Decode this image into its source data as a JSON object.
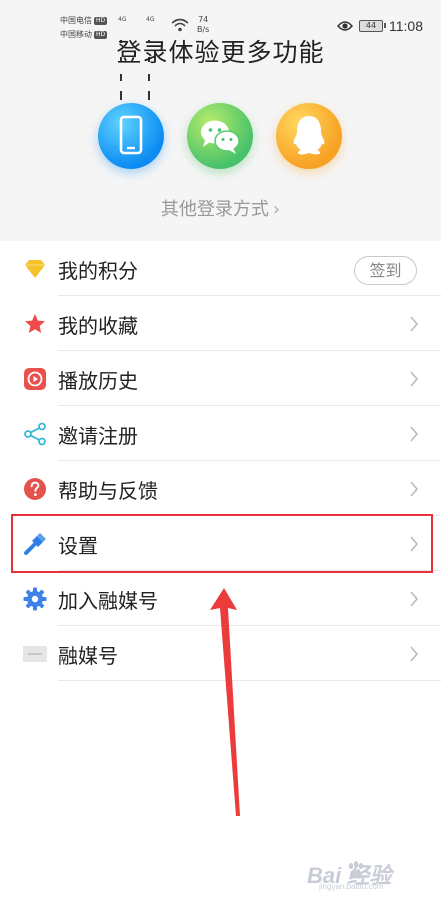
{
  "status_bar": {
    "carrier1": "中国电信",
    "carrier2": "中国移动",
    "hd": "HD",
    "network1": "4G",
    "network2": "4G",
    "speed_value": "74",
    "speed_unit": "B/s",
    "battery": "44",
    "time": "11:08"
  },
  "login": {
    "title": "登录体验更多功能",
    "options": [
      "phone-icon",
      "wechat-icon",
      "qq-icon"
    ],
    "other_login": "其他登录方式",
    "other_login_chevron": "›"
  },
  "menu": {
    "items": [
      {
        "label": "我的积分",
        "icon": "diamond-icon",
        "action": "签到"
      },
      {
        "label": "我的收藏",
        "icon": "star-icon"
      },
      {
        "label": "播放历史",
        "icon": "play-history-icon"
      },
      {
        "label": "邀请注册",
        "icon": "share-icon"
      },
      {
        "label": "帮助与反馈",
        "icon": "help-icon"
      },
      {
        "label": "设置",
        "icon": "settings-wrench-icon"
      },
      {
        "label": "加入融媒号",
        "icon": "gear-icon"
      },
      {
        "label": "融媒号",
        "icon": "media-thumbnail-icon"
      }
    ]
  },
  "annotation": {
    "highlight_color": "#e8323b",
    "target": "设置"
  },
  "watermark": {
    "text": "Bai 经验",
    "url": "jingyan.baidu.com"
  }
}
